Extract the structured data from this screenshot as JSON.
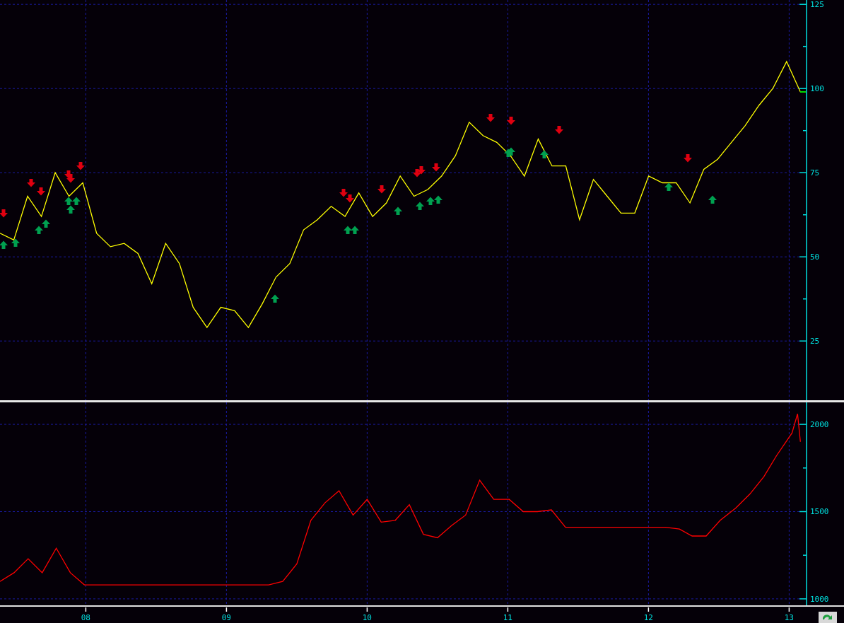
{
  "price_panel": {
    "chart_data": {
      "type": "line",
      "grid": true,
      "ylim": [
        7.4,
        126.3
      ],
      "yticks": [
        25,
        50,
        75,
        100,
        125
      ],
      "series": [
        {
          "color": "#ffff00",
          "values": [
            57,
            55,
            68,
            62,
            75,
            68,
            72,
            57,
            53,
            54,
            51,
            42,
            54,
            48,
            35,
            29,
            35,
            34,
            29,
            36,
            44,
            48,
            58,
            61,
            65,
            62,
            69,
            62,
            66,
            74,
            68,
            70,
            74,
            80,
            90,
            86,
            84,
            80,
            74,
            85,
            77,
            77,
            61,
            73,
            68,
            63,
            63,
            74,
            72,
            72,
            66,
            76,
            79,
            84,
            89,
            95,
            100,
            108,
            99
          ]
        }
      ]
    }
  },
  "equity_panel": {
    "chart_data": {
      "type": "line",
      "grid": true,
      "xlim": [
        2007.39,
        2013.39
      ],
      "ylim": [
        963,
        2126
      ],
      "xticks": [
        {
          "value": 2008,
          "label": "08"
        },
        {
          "value": 2009,
          "label": "09"
        },
        {
          "value": 2010,
          "label": "10"
        },
        {
          "value": 2011,
          "label": "11"
        },
        {
          "value": 2012,
          "label": "12"
        },
        {
          "value": 2013,
          "label": "13"
        }
      ],
      "yticks": [
        1000,
        1500,
        2000
      ],
      "x": [
        2007.39,
        2007.49,
        2007.59,
        2007.69,
        2007.79,
        2007.89,
        2007.99,
        2008.09,
        2008.19,
        2008.29,
        2008.39,
        2008.49,
        2008.59,
        2008.69,
        2008.79,
        2008.89,
        2008.99,
        2009.1,
        2009.2,
        2009.3,
        2009.4,
        2009.5,
        2009.6,
        2009.7,
        2009.8,
        2009.9,
        2010.0,
        2010.1,
        2010.2,
        2010.3,
        2010.4,
        2010.5,
        2010.6,
        2010.7,
        2010.8,
        2010.9,
        2011.01,
        2011.11,
        2011.21,
        2011.31,
        2011.41,
        2011.51,
        2011.61,
        2011.71,
        2011.81,
        2011.91,
        2012.01,
        2012.12,
        2012.22,
        2012.31,
        2012.41,
        2012.51,
        2012.62,
        2012.72,
        2012.82,
        2012.91,
        2013.02,
        2013.06,
        2013.08
      ],
      "series": [
        {
          "color": "#ff0000",
          "values": [
            1100,
            1150,
            1230,
            1150,
            1290,
            1150,
            1080,
            1080,
            1080,
            1080,
            1080,
            1080,
            1080,
            1080,
            1080,
            1080,
            1080,
            1080,
            1080,
            1080,
            1100,
            1200,
            1450,
            1550,
            1620,
            1480,
            1570,
            1440,
            1450,
            1540,
            1370,
            1350,
            1420,
            1480,
            1680,
            1570,
            1570,
            1500,
            1500,
            1510,
            1410,
            1410,
            1410,
            1410,
            1410,
            1410,
            1410,
            1410,
            1400,
            1360,
            1360,
            1450,
            1520,
            1600,
            1700,
            1820,
            1950,
            2060,
            1900
          ]
        }
      ]
    }
  }
}
